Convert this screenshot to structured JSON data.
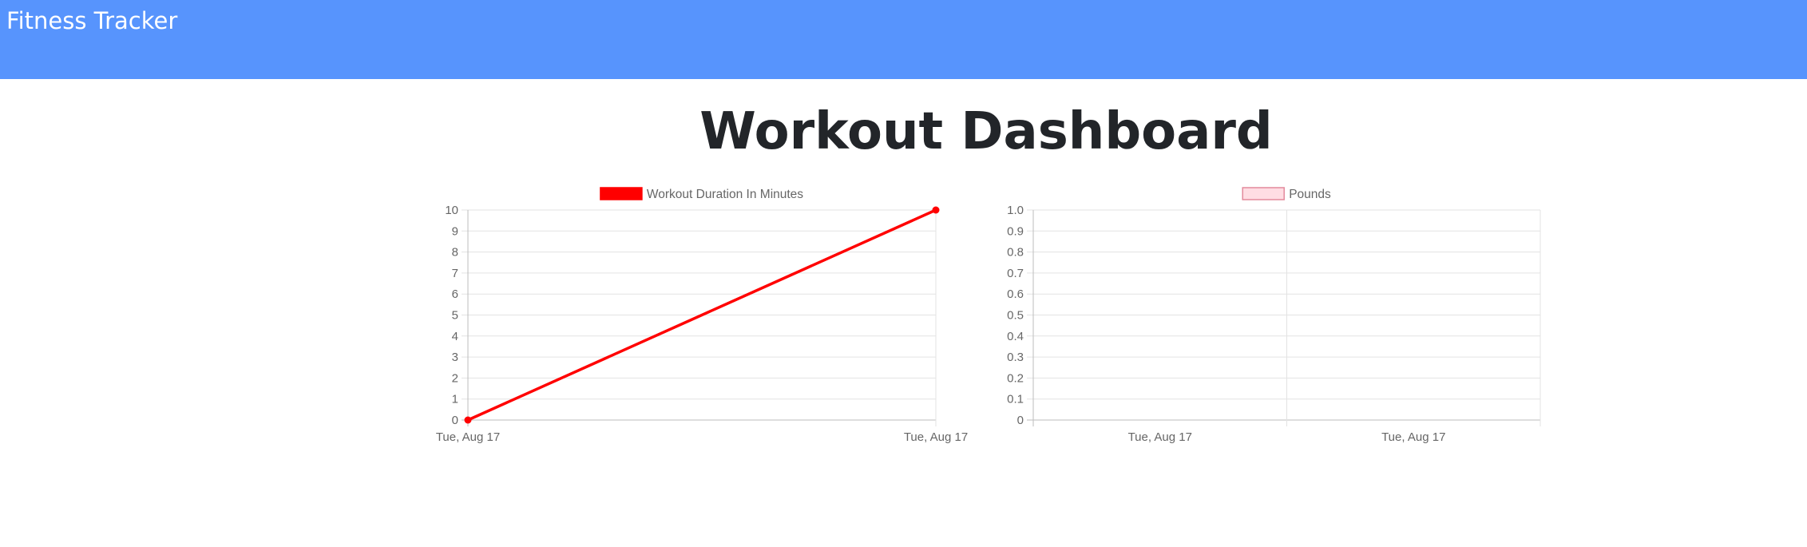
{
  "navbar": {
    "brand": "Fitness Tracker",
    "color": "#5794fd"
  },
  "page": {
    "title": "Workout Dashboard"
  },
  "chart_data": [
    {
      "type": "line",
      "legend": "Workout Duration In Minutes",
      "legend_placement": "top",
      "color": "#ff0000",
      "categories": [
        "Tue, Aug 17",
        "Tue, Aug 17"
      ],
      "values": [
        0,
        10
      ],
      "yticks": [
        "0",
        "1",
        "2",
        "3",
        "4",
        "5",
        "6",
        "7",
        "8",
        "9",
        "10"
      ],
      "ylim": [
        0,
        10
      ],
      "grid": true
    },
    {
      "type": "bar",
      "legend": "Pounds",
      "legend_placement": "top",
      "color": "#ffdde3",
      "border_color": "#e38a9c",
      "categories": [
        "Tue, Aug 17",
        "Tue, Aug 17"
      ],
      "values": [],
      "yticks": [
        "0",
        "0.1",
        "0.2",
        "0.3",
        "0.4",
        "0.5",
        "0.6",
        "0.7",
        "0.8",
        "0.9",
        "1.0"
      ],
      "ylim": [
        0,
        1
      ],
      "grid": true
    }
  ]
}
